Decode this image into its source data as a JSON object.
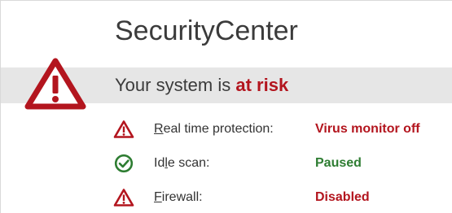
{
  "app": {
    "title": "SecurityCenter"
  },
  "status": {
    "prefix": "Your system is ",
    "highlight": "at risk",
    "icon": "warning-icon",
    "color": "#b3151e"
  },
  "items": [
    {
      "label_before": "",
      "label_mnemonic": "R",
      "label_after": "eal time protection:",
      "status": "Virus monitor off",
      "icon": "warning-icon",
      "state": "bad"
    },
    {
      "label_before": "Id",
      "label_mnemonic": "l",
      "label_after": "e scan:",
      "status": "Paused",
      "icon": "check-circle-icon",
      "state": "ok"
    },
    {
      "label_before": "",
      "label_mnemonic": "F",
      "label_after": "irewall:",
      "status": "Disabled",
      "icon": "warning-icon",
      "state": "bad"
    }
  ],
  "colors": {
    "danger": "#b3151e",
    "ok": "#2e7d32",
    "band": "#e6e6e6"
  }
}
